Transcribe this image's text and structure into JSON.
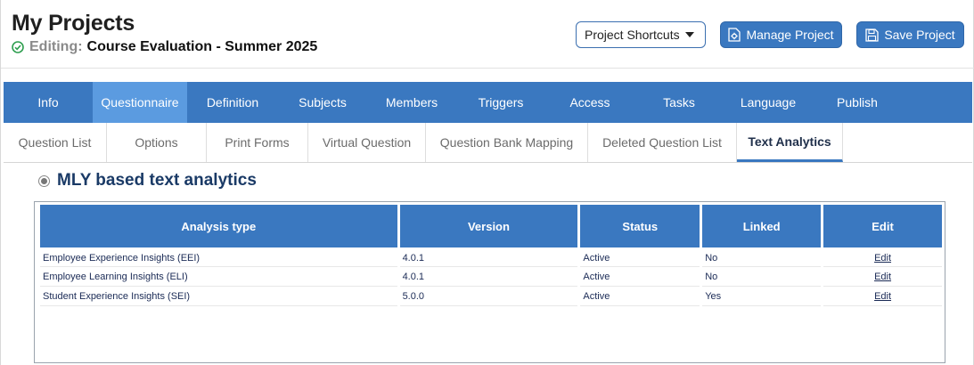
{
  "header": {
    "title": "My Projects",
    "editing_label": "Editing:",
    "project_name": "Course Evaluation - Summer 2025",
    "shortcuts_label": "Project Shortcuts",
    "manage_label": "Manage Project",
    "save_label": "Save Project"
  },
  "main_tabs": [
    "Info",
    "Questionnaire",
    "Definition",
    "Subjects",
    "Members",
    "Triggers",
    "Access",
    "Tasks",
    "Language",
    "Publish"
  ],
  "main_tabs_active": "Questionnaire",
  "sub_tabs": [
    "Question List",
    "Options",
    "Print Forms",
    "Virtual Question",
    "Question Bank Mapping",
    "Deleted Question List",
    "Text Analytics"
  ],
  "sub_tabs_active": "Text Analytics",
  "section": {
    "title": "MLY based text analytics"
  },
  "table": {
    "headers": [
      "Analysis type",
      "Version",
      "Status",
      "Linked",
      "Edit"
    ],
    "rows": [
      {
        "type": "Employee Experience Insights (EEI)",
        "version": "4.0.1",
        "status": "Active",
        "linked": "No",
        "edit": "Edit"
      },
      {
        "type": "Employee Learning Insights (ELI)",
        "version": "4.0.1",
        "status": "Active",
        "linked": "No",
        "edit": "Edit"
      },
      {
        "type": "Student Experience Insights (SEI)",
        "version": "5.0.0",
        "status": "Active",
        "linked": "Yes",
        "edit": "Edit"
      }
    ]
  },
  "colors": {
    "primary": "#3a78c0",
    "active_tab": "#5b9be0",
    "heading": "#1a3a66"
  }
}
